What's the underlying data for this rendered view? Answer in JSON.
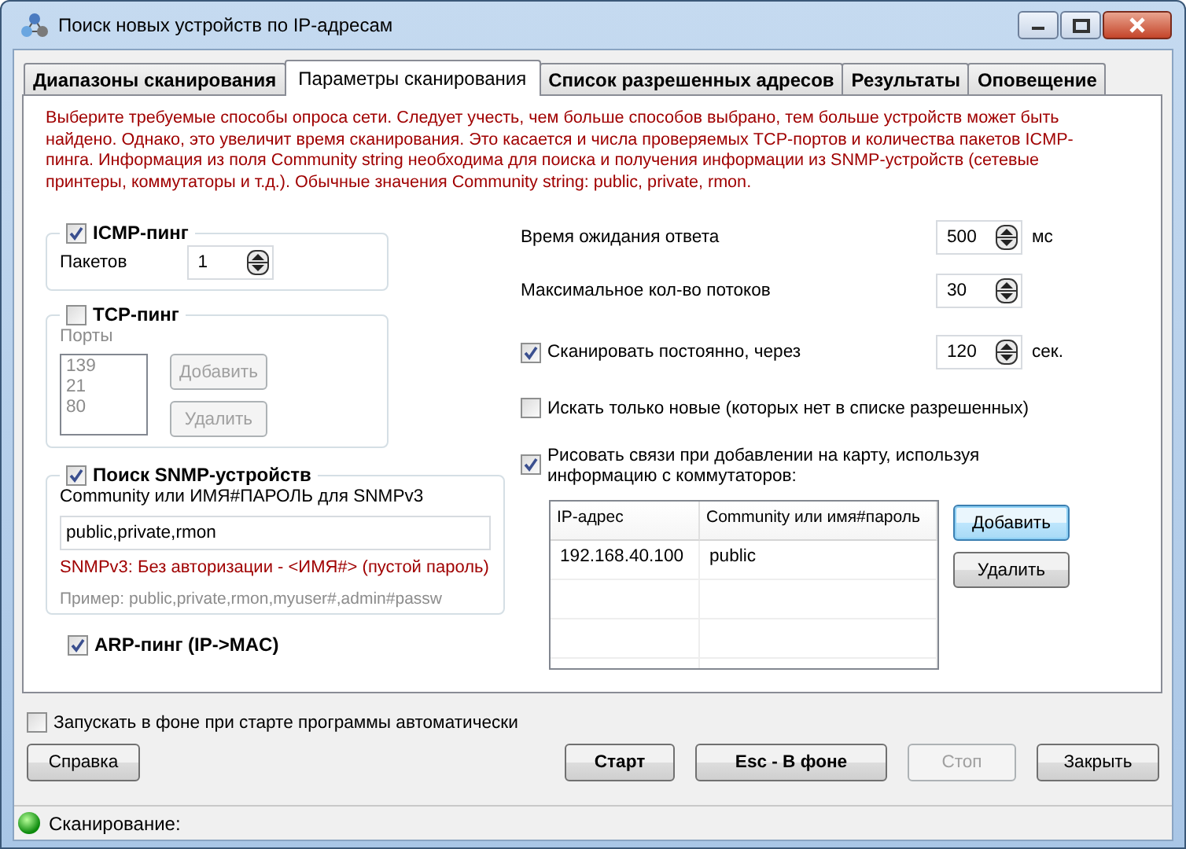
{
  "window": {
    "title": "Поиск новых устройств по IP-адресам"
  },
  "tabs": [
    {
      "label": "Диапазоны сканирования",
      "selected": false
    },
    {
      "label": "Параметры сканирования",
      "selected": true
    },
    {
      "label": "Список разрешенных адресов",
      "selected": false
    },
    {
      "label": "Результаты",
      "selected": false
    },
    {
      "label": "Оповещение",
      "selected": false
    }
  ],
  "description": "Выберите требуемые способы опроса сети. Следует учесть, чем больше способов выбрано, тем больше устройств может быть найдено. Однако, это увеличит время сканирования. Это касается и числа проверяемых TCP-портов и количества пакетов ICMP-пинга. Информация из поля Community string необходима для поиска и получения информации из SNMP-устройств (сетевые принтеры, коммутаторы и т.д.). Обычные значения Community string: public, private, rmon.",
  "icmp": {
    "label": "ICMP-пинг",
    "checked": true,
    "packets_label": "Пакетов",
    "packets_value": "1"
  },
  "tcp": {
    "label": "TCP-пинг",
    "checked": false,
    "ports_label": "Порты",
    "ports": [
      "139",
      "21",
      "80"
    ],
    "add_button": "Добавить",
    "remove_button": "Удалить"
  },
  "snmp": {
    "label": "Поиск SNMP-устройств",
    "checked": true,
    "community_label": "Community или ИМЯ#ПАРОЛЬ для SNMPv3",
    "community_value": "public,private,rmon",
    "hint": "SNMPv3: Без авторизации - <ИМЯ#> (пустой пароль)",
    "example": "Пример: public,private,rmon,myuser#,admin#passw"
  },
  "arp": {
    "label": "ARP-пинг (IP->MAC)",
    "checked": true
  },
  "timeout": {
    "label": "Время ожидания ответа",
    "value": "500",
    "unit": "мс"
  },
  "threads": {
    "label": "Максимальное кол-во потоков",
    "value": "30"
  },
  "continuous": {
    "label": "Сканировать постоянно, через",
    "checked": true,
    "value": "120",
    "unit": "сек."
  },
  "only_new": {
    "label": "Искать только новые (которых нет в списке разрешенных)",
    "checked": false
  },
  "draw_links": {
    "label": "Рисовать связи при добавлении на карту, используя информацию с коммутаторов:",
    "checked": true,
    "table": {
      "columns": [
        "IP-адрес",
        "Community или имя#пароль"
      ],
      "rows": [
        [
          "192.168.40.100",
          "public"
        ]
      ]
    },
    "add_button": "Добавить",
    "remove_button": "Удалить"
  },
  "autostart": {
    "label": "Запускать в фоне при старте программы автоматически",
    "checked": false
  },
  "buttons": [
    {
      "label": "Справка",
      "kind": "help",
      "bold": false,
      "disabled": false
    },
    {
      "label": "Старт",
      "kind": "action",
      "bold": true,
      "disabled": false
    },
    {
      "label": "Esc - В фоне",
      "kind": "action",
      "bold": true,
      "disabled": false
    },
    {
      "label": "Стоп",
      "kind": "action",
      "bold": false,
      "disabled": true
    },
    {
      "label": "Закрыть",
      "kind": "action",
      "bold": false,
      "disabled": false
    }
  ],
  "status": {
    "text": "Сканирование:"
  }
}
